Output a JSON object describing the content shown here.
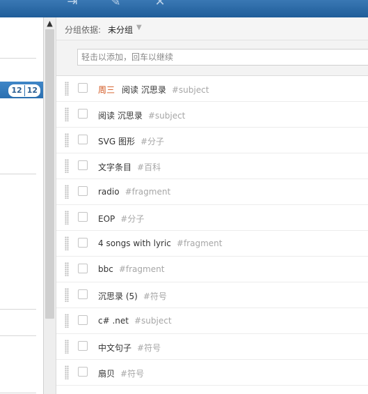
{
  "toolbar": {
    "icons": [
      "move-to-icon",
      "edit-pencil-icon",
      "delete-x-icon"
    ]
  },
  "sidebar": {
    "active_counts": [
      "12",
      "12"
    ]
  },
  "group": {
    "label": "分组依据:",
    "value": "未分组"
  },
  "add_task": {
    "placeholder": "轻击以添加，回车以继续"
  },
  "tasks": [
    {
      "date": "周三",
      "title": "阅读 沉思录",
      "tag": "#subject"
    },
    {
      "date": "",
      "title": "阅读 沉思录",
      "tag": "#subject"
    },
    {
      "date": "",
      "title": "SVG 图形",
      "tag": "#分子"
    },
    {
      "date": "",
      "title": "文字条目",
      "tag": "#百科"
    },
    {
      "date": "",
      "title": "radio",
      "tag": "#fragment"
    },
    {
      "date": "",
      "title": "EOP",
      "tag": "#分子"
    },
    {
      "date": "",
      "title": "4 songs with lyric",
      "tag": "#fragment"
    },
    {
      "date": "",
      "title": "bbc",
      "tag": "#fragment"
    },
    {
      "date": "",
      "title": "沉思录 (5)",
      "tag": "#符号"
    },
    {
      "date": "",
      "title": "c# .net",
      "tag": "#subject"
    },
    {
      "date": "",
      "title": "中文句子",
      "tag": "#符号"
    },
    {
      "date": "",
      "title": "扇贝",
      "tag": "#符号"
    }
  ]
}
